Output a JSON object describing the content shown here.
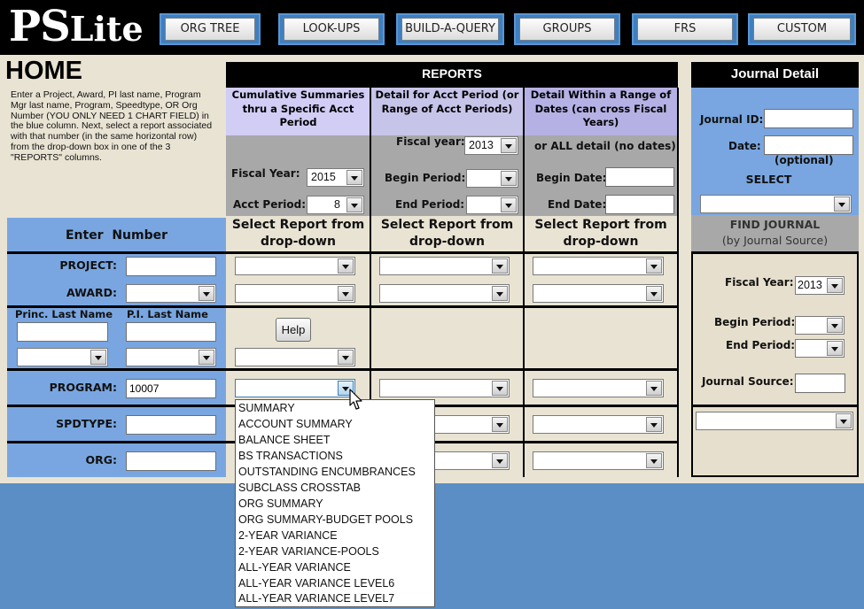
{
  "app": {
    "logo_ps": "PS",
    "logo_lite": "Lite"
  },
  "nav": [
    "ORG TREE",
    "LOOK-UPS",
    "BUILD-A-QUERY",
    "GROUPS",
    "FRS",
    "CUSTOM"
  ],
  "home": {
    "title": "HOME",
    "instructions": "Enter a Project, Award, PI last name, Program Mgr last name, Program, Speedtype, OR Org Number (YOU ONLY NEED 1 CHART FIELD) in the blue column.  Next, select a report associated with that number (in the same horizontal row) from the drop-down box in one of the 3 \"REPORTS\" columns."
  },
  "reports": {
    "title": "REPORTS",
    "col1_header": "Cumulative Summaries thru a Specific Acct Period",
    "col2_header": "Detail for Acct Period (or Range of Acct Periods)",
    "col3_header": "Detail Within a Range of Dates (can cross Fiscal Years)",
    "col1": {
      "fiscal_year_label": "Fiscal Year:",
      "fiscal_year": "2015",
      "acct_period_label": "Acct Period:",
      "acct_period": "8"
    },
    "col2": {
      "fiscal_year_label": "Fiscal year:",
      "fiscal_year": "2013",
      "begin_label": "Begin Period:",
      "end_label": "End Period:"
    },
    "col3": {
      "all_detail_label": "or ALL detail (no dates)",
      "begin_label": "Begin Date:",
      "end_label": "End Date:"
    },
    "select_header": "Select Report from drop-down",
    "help_button": "Help"
  },
  "enter_number": {
    "header": "Enter  Number",
    "project_label": "PROJECT:",
    "award_label": "AWARD:",
    "princ_last_name_label": "Princ. Last Name",
    "pi_last_name_label": "P.I. Last Name",
    "program_label": "PROGRAM:",
    "program_value": "10007",
    "spdtype_label": "SPDTYPE:",
    "org_label": "ORG:"
  },
  "journal": {
    "title": "Journal Detail",
    "journal_id_label": "Journal ID:",
    "date_label": "Date:",
    "optional": "(optional)",
    "select_label": "SELECT",
    "find_title": "FIND JOURNAL",
    "find_subtitle": "(by Journal Source)",
    "fiscal_year_label": "Fiscal Year:",
    "fiscal_year": "2013",
    "begin_period_label": "Begin Period:",
    "end_period_label": "End Period:",
    "journal_source_label": "Journal Source:"
  },
  "report_options": [
    "SUMMARY",
    "ACCOUNT SUMMARY",
    "BALANCE SHEET",
    "BS TRANSACTIONS",
    "OUTSTANDING ENCUMBRANCES",
    "SUBCLASS CROSSTAB",
    "ORG SUMMARY",
    "ORG SUMMARY-BUDGET POOLS",
    "2-YEAR VARIANCE",
    "2-YEAR VARIANCE-POOLS",
    "ALL-YEAR VARIANCE",
    "ALL-YEAR VARIANCE LEVEL6",
    "ALL-YEAR VARIANCE LEVEL7"
  ]
}
